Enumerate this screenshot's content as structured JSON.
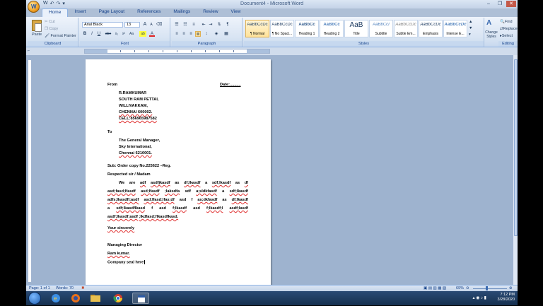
{
  "window": {
    "title": "Document4 - Microsoft Word",
    "office_button_glyph": "W",
    "qat": [
      "W",
      "↶",
      "↷",
      "▾"
    ],
    "controls": [
      "–",
      "❐",
      "✕"
    ]
  },
  "tabs": [
    "Home",
    "Insert",
    "Page Layout",
    "References",
    "Mailings",
    "Review",
    "View"
  ],
  "ribbon": {
    "clipboard": {
      "label": "Clipboard",
      "paste": "Paste",
      "cut": "Cut",
      "copy": "Copy",
      "format_painter": "Format Painter"
    },
    "font": {
      "label": "Font",
      "font_name": "Arial Black",
      "font_size": "13",
      "grow": "A",
      "shrink": "A",
      "bold": "B",
      "italic": "I",
      "underline": "U",
      "strike": "abe",
      "sub": "x₂",
      "sup": "x²",
      "case": "Aa",
      "highlight": "ab",
      "color": "A"
    },
    "paragraph": {
      "label": "Paragraph"
    },
    "styles": {
      "label": "Styles",
      "items": [
        {
          "sample": "AaBbCcDc",
          "name": "¶ Normal"
        },
        {
          "sample": "AaBbCcDc",
          "name": "¶ No Spaci..."
        },
        {
          "sample": "AaBbCc",
          "name": "Heading 1"
        },
        {
          "sample": "AaBbCc",
          "name": "Heading 2"
        },
        {
          "sample": "AaB",
          "name": "Title"
        },
        {
          "sample": "AaBbCcI",
          "name": "Subtitle"
        },
        {
          "sample": "AaBbCcDc",
          "name": "Subtle Em..."
        },
        {
          "sample": "AaBbCcDc",
          "name": "Emphasis"
        },
        {
          "sample": "AaBbCcDc",
          "name": "Intense E..."
        }
      ],
      "change_styles": "Change Styles"
    },
    "editing": {
      "label": "Editing",
      "find": "Find",
      "replace": "Replace",
      "select": "Select"
    }
  },
  "document": {
    "from": "From",
    "date": "Date:..........",
    "sender": [
      "R.RAMKUMAR",
      "SOUTH RAM PETTAI,",
      "WILLIVAKKAM,",
      "CHENNAI 600002.",
      "CELL:856965987582"
    ],
    "to": "To",
    "recipient": [
      "The General Manager,",
      "Sky International,",
      "Chennai 6210001."
    ],
    "subject": "Sub: Order copy No.225622 –Reg.",
    "salutation": "Respected sir / Madam",
    "body_lines": [
      [
        "We",
        "are",
        "adf",
        "asdfjkasdf",
        "as",
        "df;lkasdf",
        "a",
        "sdf;lkasdf",
        "as",
        "df"
      ],
      [
        "asd;fasd;lfasdf",
        "asd;lfasdf",
        ";laksdfa",
        "sdf",
        "a;sldkfasdf",
        "a",
        "sdf;lkasdf"
      ],
      [
        "adfs;lkasdfl;asdf",
        "asd;lfasd;lfas;df",
        "asd",
        "f",
        "as;dkfasdf",
        "as",
        "df;lkasdf"
      ],
      [
        "a",
        "sdf;lkasdflkasd",
        "f",
        "asd",
        "f;lkasdf",
        "asd",
        "f;lkasdf;l",
        "asdf;lasdf"
      ],
      [
        "asdf;lkasdf;asdf",
        ";lkdfasd;flkasdfkasd."
      ]
    ],
    "closing": "Your sincerely",
    "designation": "Managing Director",
    "name": "Ram kumar.",
    "seal": "Company seal here"
  },
  "status": {
    "page": "Page: 1 of 1",
    "words": "Words: 70",
    "zoom": "69%"
  },
  "taskbar": {
    "time": "7:12 PM",
    "date": "3/28/2020"
  },
  "colors": {
    "ribbon_accent": "#15428b",
    "spell_underline": "#e03030",
    "taskbar": "#1c3a60"
  }
}
